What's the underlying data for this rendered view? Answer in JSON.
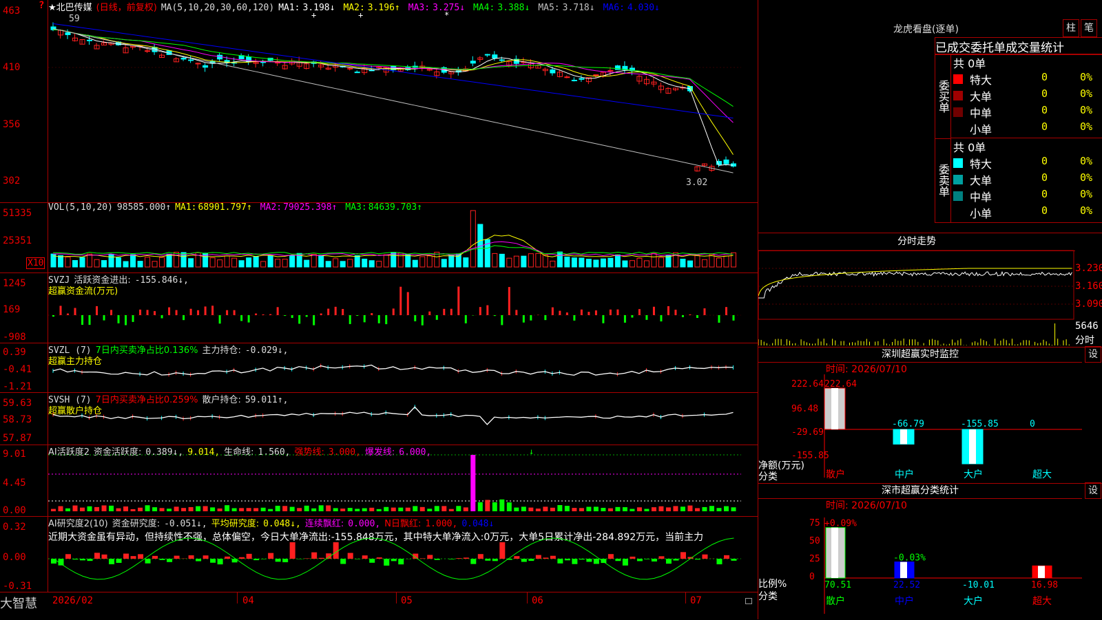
{
  "stock": {
    "name": "★北巴传媒",
    "mode": "(日线，前复权)",
    "logo_question": "?"
  },
  "main": {
    "ma_label": "MA(5,10,20,30,60,120)",
    "ma": [
      {
        "name": "MA1:",
        "value": "3.198↓",
        "color": "#ffffff"
      },
      {
        "name": "MA2:",
        "value": "3.196↑",
        "color": "#ffff00"
      },
      {
        "name": "MA3:",
        "value": "3.275↓",
        "color": "#ff00ff"
      },
      {
        "name": "MA4:",
        "value": "3.388↓",
        "color": "#00ff00"
      },
      {
        "name": "MA5:",
        "value": "3.718↓",
        "color": "#c0c0c0"
      },
      {
        "name": "MA6:",
        "value": "4.030↓",
        "color": "#0000ff"
      }
    ],
    "y_ticks": [
      "463",
      "410",
      "356",
      "302"
    ],
    "high_note": "59",
    "low_note": "3.02"
  },
  "vol": {
    "label": "VOL(5,10,20)",
    "value": "98585.000↑",
    "items": [
      {
        "name": "MA1:",
        "value": "68901.797↑",
        "color": "#ffff00"
      },
      {
        "name": "MA2:",
        "value": "79025.398↑",
        "color": "#ff00ff"
      },
      {
        "name": "MA3:",
        "value": "84639.703↑",
        "color": "#00ff00"
      }
    ],
    "y_ticks": [
      "51335",
      "25351"
    ],
    "unit": "X10"
  },
  "svzj": {
    "label": "SVZJ",
    "desc": "活跃资金进出:",
    "value": "-155.846↓,",
    "sub": "超赢资金流(万元)",
    "y_ticks": [
      "1245",
      "169",
      "-908"
    ]
  },
  "svzl": {
    "label": "SVZL (7)",
    "desc1": "7日内买卖净占比0.136%",
    "desc2": "主力持仓:",
    "value": "-0.029↓,",
    "sub": "超赢主力持仓",
    "y_ticks": [
      "0.39",
      "-0.41",
      "-1.21"
    ]
  },
  "svsh": {
    "label": "SVSH (7)",
    "desc1": "7日内买卖净占比0.259%",
    "desc2": "散户持仓:",
    "value": "59.011↑,",
    "sub": "超赢散户持仓",
    "y_ticks": [
      "59.63",
      "58.73",
      "57.87"
    ]
  },
  "ai1": {
    "label": "AI活跃度2",
    "d1": "资金活跃度:",
    "v1": "0.389↓,",
    "v2": "9.014,",
    "d3": "生命线:",
    "v3": "1.560,",
    "d4": "强势线:",
    "v4": "3.000,",
    "d5": "爆发线:",
    "v5": "6.000,",
    "y_ticks": [
      "9.01",
      "4.45",
      "0.00"
    ]
  },
  "ai2": {
    "label": "AI研究度2(10)",
    "d1": "资金研究度:",
    "v1": "-0.051↓,",
    "d2": "平均研究度:",
    "v2": "0.048↓,",
    "d3": "连续飘红:",
    "v3": "0.000,",
    "d4": "N日飘红:",
    "v4": "1.000,",
    "v5": "0.048↓",
    "comment": "近期大资金虽有异动，但持续性不强，总体偏空，今日大单净流出:-155.848万元，其中特大单净流入:0万元，大单5日累计净出-284.892万元，当前主力",
    "y_ticks": [
      "0.32",
      "0.00",
      "-0.31"
    ]
  },
  "x_axis": {
    "brand": "大智慧",
    "labels": [
      "2026/02",
      "04",
      "05",
      "06",
      "07"
    ]
  },
  "dragon": {
    "title": "龙虎看盘(逐单)",
    "btn1": "柱",
    "btn2": "笔",
    "header": "已成交委托单成交量统计",
    "buy": {
      "label": "委买单",
      "total": "共 0单",
      "rows": [
        {
          "name": "特大",
          "count": "0",
          "pct": "0%",
          "color": "#ff0000"
        },
        {
          "name": "大单",
          "count": "0",
          "pct": "0%",
          "color": "#a00000"
        },
        {
          "name": "中单",
          "count": "0",
          "pct": "0%",
          "color": "#700000"
        },
        {
          "name": "小单",
          "count": "0",
          "pct": "0%",
          "color": "#000000"
        }
      ]
    },
    "sell": {
      "label": "委卖单",
      "total": "共 0单",
      "rows": [
        {
          "name": "特大",
          "count": "0",
          "pct": "0%",
          "color": "#00ffff"
        },
        {
          "name": "大单",
          "count": "0",
          "pct": "0%",
          "color": "#00a0a0"
        },
        {
          "name": "中单",
          "count": "0",
          "pct": "0%",
          "color": "#008080"
        },
        {
          "name": "小单",
          "count": "0",
          "pct": "0%",
          "color": "#000000"
        }
      ]
    }
  },
  "intraday": {
    "title": "分时走势",
    "ticks": [
      "3.230",
      "3.160",
      "3.090"
    ],
    "vol": "5646",
    "vol_label": "分时"
  },
  "monitor": {
    "title": "深圳超赢实时监控",
    "btn": "设",
    "time": "时间: 2026/07/10",
    "y_ticks": [
      "222.64",
      "96.48",
      "-29.69",
      "-155.85"
    ],
    "ylabel": "净额(万元)",
    "xlabel": "分类",
    "cats": [
      "散户",
      "中户",
      "大户",
      "超大"
    ],
    "values": [
      222.64,
      -66.79,
      -155.85,
      0
    ],
    "value_labels": [
      "222.64",
      "-66.79",
      "-155.85",
      "0"
    ]
  },
  "classify": {
    "title": "深市超赢分类统计",
    "btn": "设",
    "time": "时间: 2026/07/10",
    "y_ticks": [
      "75",
      "50",
      "25",
      "0"
    ],
    "ylabel": "比例%",
    "xlabel": "分类",
    "cats": [
      "散户",
      "中户",
      "大户",
      "超大"
    ],
    "values": [
      70.51,
      22.52,
      -10.01,
      16.98
    ],
    "top_labels": [
      "+0.09%",
      "-0.03%",
      "",
      ""
    ],
    "value_labels": [
      "70.51",
      "22.52",
      "-10.01",
      "16.98"
    ]
  }
}
